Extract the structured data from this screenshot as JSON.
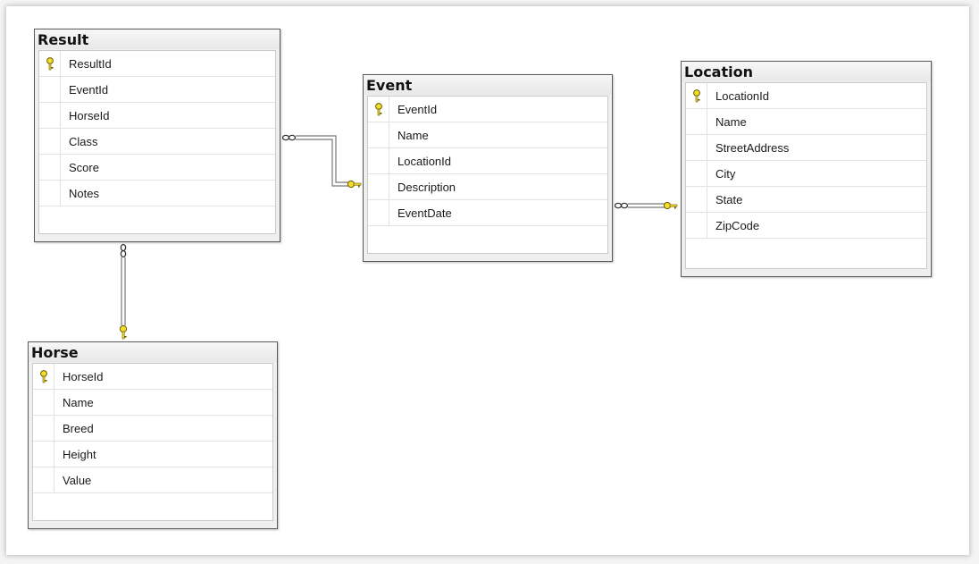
{
  "tables": {
    "result": {
      "title": "Result",
      "columns": [
        {
          "name": "ResultId",
          "pk": true
        },
        {
          "name": "EventId",
          "pk": false
        },
        {
          "name": "HorseId",
          "pk": false
        },
        {
          "name": "Class",
          "pk": false
        },
        {
          "name": "Score",
          "pk": false
        },
        {
          "name": "Notes",
          "pk": false
        }
      ]
    },
    "event": {
      "title": "Event",
      "columns": [
        {
          "name": "EventId",
          "pk": true
        },
        {
          "name": "Name",
          "pk": false
        },
        {
          "name": "LocationId",
          "pk": false
        },
        {
          "name": "Description",
          "pk": false
        },
        {
          "name": "EventDate",
          "pk": false
        }
      ]
    },
    "location": {
      "title": "Location",
      "columns": [
        {
          "name": "LocationId",
          "pk": true
        },
        {
          "name": "Name",
          "pk": false
        },
        {
          "name": "StreetAddress",
          "pk": false
        },
        {
          "name": "City",
          "pk": false
        },
        {
          "name": "State",
          "pk": false
        },
        {
          "name": "ZipCode",
          "pk": false
        }
      ]
    },
    "horse": {
      "title": "Horse",
      "columns": [
        {
          "name": "HorseId",
          "pk": true
        },
        {
          "name": "Name",
          "pk": false
        },
        {
          "name": "Breed",
          "pk": false
        },
        {
          "name": "Height",
          "pk": false
        },
        {
          "name": "Value",
          "pk": false
        }
      ]
    }
  },
  "relationships": [
    {
      "from": "result",
      "to": "event",
      "from_end": "many",
      "to_end": "one"
    },
    {
      "from": "event",
      "to": "location",
      "from_end": "many",
      "to_end": "one"
    },
    {
      "from": "result",
      "to": "horse",
      "from_end": "many",
      "to_end": "one"
    }
  ],
  "colors": {
    "key_fill": "#f2dc2c",
    "key_stroke": "#6a5a00",
    "line": "#666666"
  }
}
